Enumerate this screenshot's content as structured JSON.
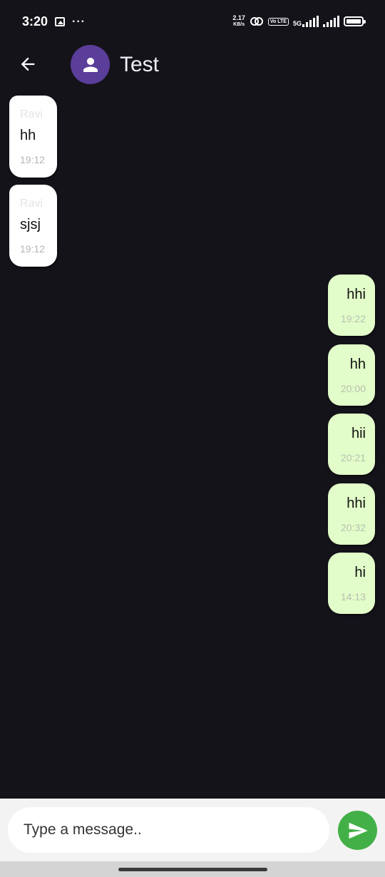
{
  "status_bar": {
    "time": "3:20",
    "more_dots": "···",
    "speed_value": "2.17",
    "speed_unit": "KB/s",
    "volte": "Vo LTE",
    "network": "5G",
    "icons": [
      "gallery-icon",
      "dots-icon",
      "hotspot-icon",
      "volte-icon",
      "signal-icon",
      "signal-icon",
      "battery-icon"
    ]
  },
  "header": {
    "back_icon": "arrow-left-icon",
    "avatar_icon": "person-icon",
    "avatar_color": "#5a3e9a",
    "title": "Test"
  },
  "messages": [
    {
      "direction": "incoming",
      "sender": "Ravi",
      "text": "hh",
      "time": "19:12"
    },
    {
      "direction": "incoming",
      "sender": "Ravi",
      "text": "sjsj",
      "time": "19:12"
    },
    {
      "direction": "outgoing",
      "text": "hhi",
      "time": "19:22"
    },
    {
      "direction": "outgoing",
      "text": "hh",
      "time": "20:00"
    },
    {
      "direction": "outgoing",
      "text": "hii",
      "time": "20:21"
    },
    {
      "direction": "outgoing",
      "text": "hhi",
      "time": "20:32"
    },
    {
      "direction": "outgoing",
      "text": "hi",
      "time": "14:13"
    }
  ],
  "composer": {
    "placeholder": "Type a message..",
    "value": "",
    "send_icon": "send-icon",
    "send_color": "#43b047"
  },
  "colors": {
    "background": "#15131a",
    "incoming_bubble": "#ffffff",
    "outgoing_bubble": "#e2fdc9"
  }
}
